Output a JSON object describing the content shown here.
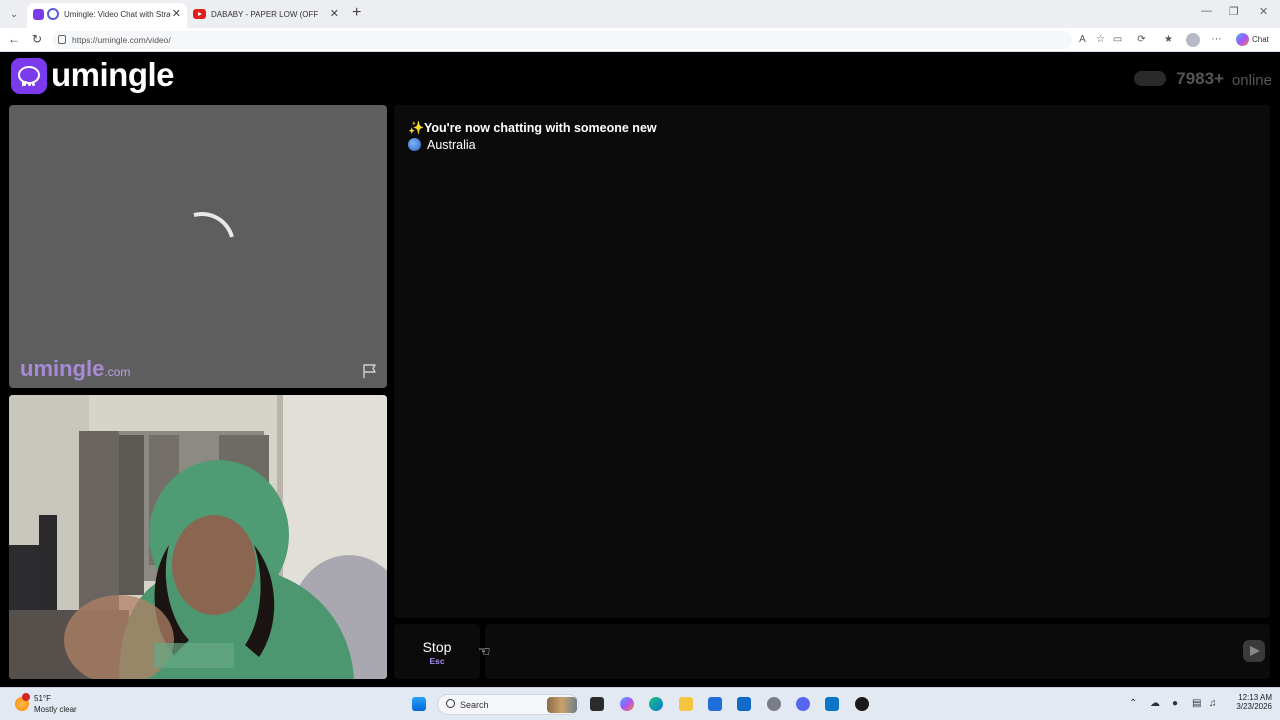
{
  "browser": {
    "tabs": [
      {
        "title": "Umingle: Video Chat with Stra",
        "active": true
      },
      {
        "title": "DABABY - PAPER LOW (OFFICIAL A",
        "active": false
      }
    ],
    "url": "https://umingle.com/video/",
    "chat_label": "Chat"
  },
  "site": {
    "logo_text": "umingle",
    "online_count": "7983+",
    "online_label": "online"
  },
  "stranger_video": {
    "watermark": "umingle",
    "watermark_suffix": ".com"
  },
  "chat": {
    "system_message": "You're now chatting with someone new",
    "country": "Australia"
  },
  "controls": {
    "stop_label": "Stop",
    "stop_hint": "Esc",
    "message_placeholder": ""
  },
  "taskbar": {
    "temperature": "51°F",
    "condition": "Mostly clear",
    "search_label": "Search",
    "time": "12:13 AM",
    "date": "3/23/2026"
  },
  "colors": {
    "brand": "#7c3aed",
    "page_bg": "#000000",
    "panel_bg": "#0b0b0b"
  }
}
